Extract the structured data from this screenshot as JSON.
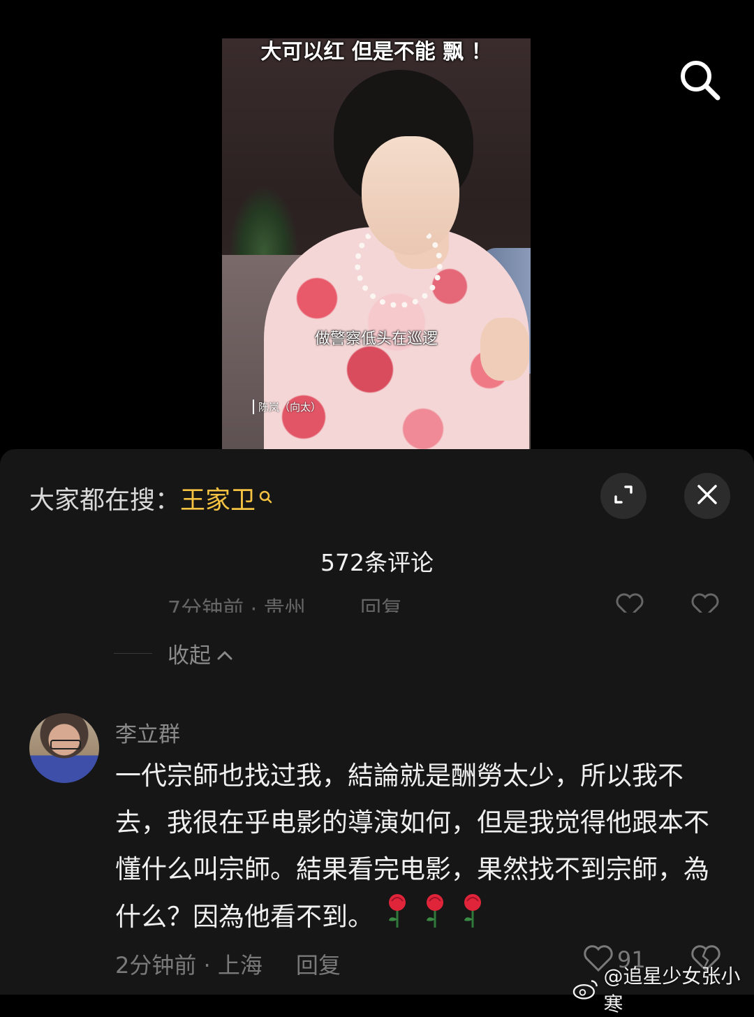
{
  "video": {
    "top_caption": "大可以红 但是不能 飘 ！",
    "subtitle": "做警察低头在巡逻",
    "name_tag": "陈岚（向太）"
  },
  "icons": {
    "search": "search-icon",
    "expand": "expand-icon",
    "close": "close-icon",
    "like": "heart-icon",
    "dislike": "broken-heart-icon",
    "rose": "rose-emoji"
  },
  "colors": {
    "keyword": "#f5c242",
    "panel_bg": "#161616",
    "muted": "#7a7a7a"
  },
  "panel": {
    "search_prefix": "大家都在搜：",
    "search_keyword": "王家卫",
    "comment_count": "572条评论",
    "faded_meta": "7分钟前 · 贵州",
    "faded_reply": "回复",
    "collapse_label": "收起"
  },
  "comment": {
    "username": "李立群",
    "text": "一代宗師也找过我，結論就是酬勞太少，所以我不去，我很在乎电影的導演如何，但是我觉得他跟本不懂什么叫宗師。結果看完电影，果然找不到宗師，為什么？因為他看不到。",
    "rose_count": 3,
    "time_location": "2分钟前 · 上海",
    "reply_label": "回复",
    "like_count": "91"
  },
  "watermark": {
    "text": "@追星少女张小寒"
  }
}
